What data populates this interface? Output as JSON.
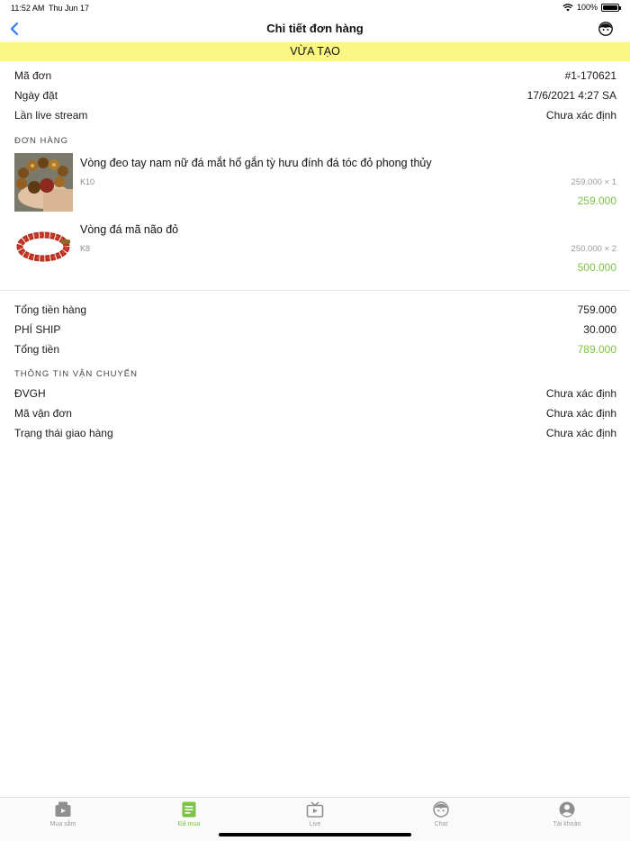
{
  "status_bar": {
    "time": "11:52 AM",
    "date": "Thu Jun 17",
    "battery": "100%"
  },
  "nav": {
    "title": "Chi tiết đơn hàng"
  },
  "order_status": "VỪA TẠO",
  "info": [
    {
      "label": "Mã đơn",
      "value": "#1-170621"
    },
    {
      "label": "Ngày đặt",
      "value": "17/6/2021 4:27 SA"
    },
    {
      "label": "Lần live stream",
      "value": "Chưa xác định"
    }
  ],
  "order_section_title": "ĐƠN HÀNG",
  "products": [
    {
      "name": "Vòng đeo tay nam nữ đá mắt hổ gắn tỳ hưu đính đá tóc đỏ phong thủy",
      "sku": "K10",
      "qty": "259.000 × 1",
      "price": "259.000"
    },
    {
      "name": "Vòng đá mã não đỏ",
      "sku": "K8",
      "qty": "250.000 × 2",
      "price": "500.000"
    }
  ],
  "totals": [
    {
      "label": "Tổng tiền hàng",
      "value": "759.000"
    },
    {
      "label": "PHÍ SHIP",
      "value": "30.000"
    },
    {
      "label": "Tổng tiền",
      "value": "789.000"
    }
  ],
  "shipping_section_title": "THÔNG TIN VẬN CHUYỂN",
  "shipping": [
    {
      "label": "ĐVGH",
      "value": "Chưa xác định"
    },
    {
      "label": "Mã vận đơn",
      "value": "Chưa xác định"
    },
    {
      "label": "Trạng thái giao hàng",
      "value": "Chưa xác định"
    }
  ],
  "tabs": [
    {
      "label": "Mua sắm",
      "icon": "shopping-icon"
    },
    {
      "label": "Đã mua",
      "icon": "purchased-list-icon"
    },
    {
      "label": "Live",
      "icon": "live-tv-icon"
    },
    {
      "label": "Chat",
      "icon": "chat-face-icon"
    },
    {
      "label": "Tài khoản",
      "icon": "account-icon"
    }
  ],
  "colors": {
    "accent_green": "#7cc243",
    "banner_yellow": "#fcf783",
    "back_blue": "#2f7cf6",
    "tab_inactive": "#9a9a9a"
  }
}
